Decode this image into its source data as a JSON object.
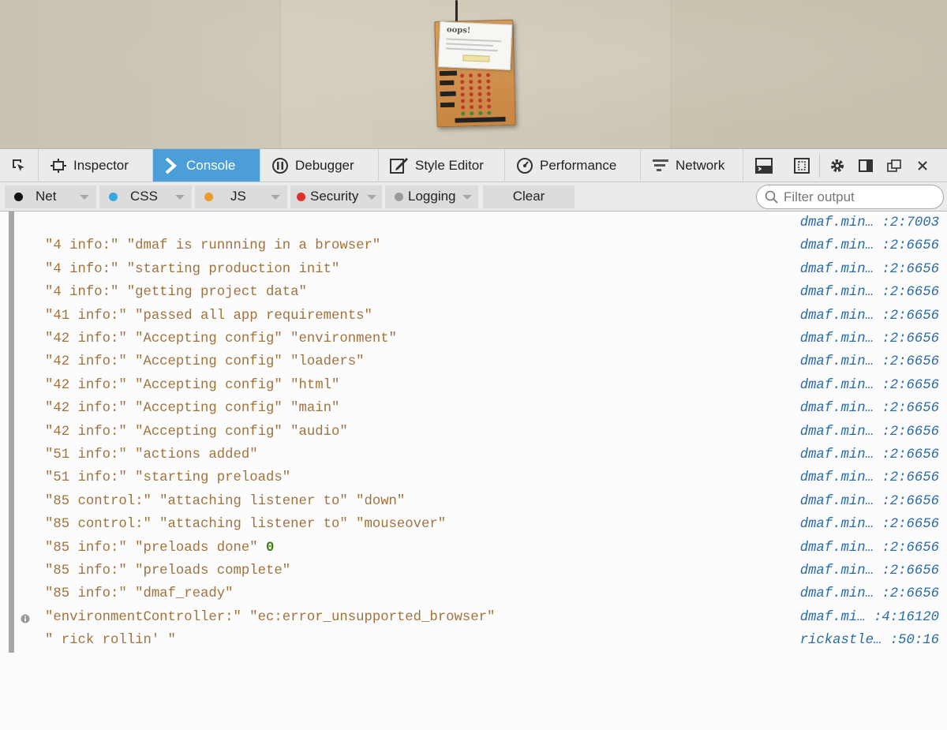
{
  "toolbar": {
    "tabs": [
      {
        "label": "Inspector",
        "icon": "inspector-icon"
      },
      {
        "label": "Console",
        "icon": "console-icon",
        "active": true
      },
      {
        "label": "Debugger",
        "icon": "debugger-icon"
      },
      {
        "label": "Style Editor",
        "icon": "style-editor-icon"
      },
      {
        "label": "Performance",
        "icon": "performance-icon"
      },
      {
        "label": "Network",
        "icon": "network-icon"
      }
    ],
    "accent_color": "#4c9ed9"
  },
  "filterbar": {
    "filters": [
      {
        "label": "Net",
        "dot_color": "#111111"
      },
      {
        "label": "CSS",
        "dot_color": "#34a8e0"
      },
      {
        "label": "JS",
        "dot_color": "#ee9a2a"
      },
      {
        "label": "Security",
        "dot_color": "#e0302a"
      },
      {
        "label": "Logging",
        "dot_color": "#9a9a9a"
      }
    ],
    "clear_label": "Clear",
    "filter_placeholder": "Filter output"
  },
  "console": {
    "messages": [
      {
        "text": "",
        "location": "dmaf.min… :2:7003"
      },
      {
        "text": "\"4 info:\" \"dmaf is runnning in a browser\"",
        "location": "dmaf.min… :2:6656"
      },
      {
        "text": "\"4 info:\" \"starting production init\"",
        "location": "dmaf.min… :2:6656"
      },
      {
        "text": "\"4 info:\" \"getting project data\"",
        "location": "dmaf.min… :2:6656"
      },
      {
        "text": "\"41 info:\" \"passed all app requirements\"",
        "location": "dmaf.min… :2:6656"
      },
      {
        "text": "\"42 info:\" \"Accepting config\" \"environment\"",
        "location": "dmaf.min… :2:6656"
      },
      {
        "text": "\"42 info:\" \"Accepting config\" \"loaders\"",
        "location": "dmaf.min… :2:6656"
      },
      {
        "text": "\"42 info:\" \"Accepting config\" \"html\"",
        "location": "dmaf.min… :2:6656"
      },
      {
        "text": "\"42 info:\" \"Accepting config\" \"main\"",
        "location": "dmaf.min… :2:6656"
      },
      {
        "text": "\"42 info:\" \"Accepting config\" \"audio\"",
        "location": "dmaf.min… :2:6656"
      },
      {
        "text": "\"51 info:\" \"actions added\"",
        "location": "dmaf.min… :2:6656"
      },
      {
        "text": "\"51 info:\" \"starting preloads\"",
        "location": "dmaf.min… :2:6656"
      },
      {
        "text": "\"85 control:\" \"attaching listener to\" \"down\"",
        "location": "dmaf.min… :2:6656"
      },
      {
        "text": "\"85 control:\" \"attaching listener to\" \"mouseover\"",
        "location": "dmaf.min… :2:6656"
      },
      {
        "text": "\"85 info:\" \"preloads done\" ",
        "number": "0",
        "location": "dmaf.min… :2:6656"
      },
      {
        "text": "\"85 info:\" \"preloads complete\"",
        "location": "dmaf.min… :2:6656"
      },
      {
        "text": "\"85 info:\" \"dmaf_ready\"",
        "location": "dmaf.min… :2:6656"
      },
      {
        "text": "\"environmentController:\" \"ec:error_unsupported_browser\"",
        "location": "dmaf.mi… :4:16120",
        "icon": "info-icon"
      },
      {
        "text": "\" rick rollin' \"",
        "location": "rickastle… :50:16"
      }
    ]
  },
  "page": {
    "device_card_title": "oops!"
  }
}
